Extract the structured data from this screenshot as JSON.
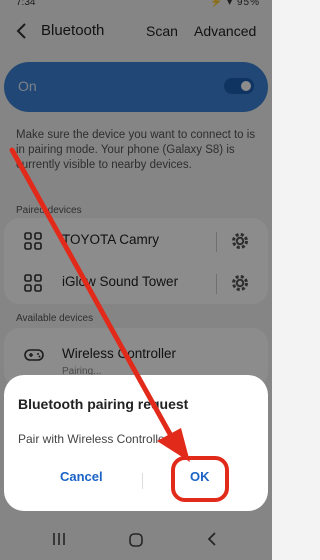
{
  "status_bar": {
    "time": "7:34",
    "battery": "95%"
  },
  "header": {
    "title": "Bluetooth",
    "scan": "Scan",
    "advanced": "Advanced"
  },
  "master_toggle": {
    "label": "On",
    "state": "on"
  },
  "info_text": "Make sure the device you want to connect to is in pairing mode. Your phone (Galaxy S8) is currently visible to nearby devices.",
  "paired": {
    "label": "Paired devices",
    "devices": [
      {
        "name": "TOYOTA Camry",
        "icon": "grid-device-icon"
      },
      {
        "name": "iGlow Sound Tower",
        "icon": "grid-device-icon"
      }
    ]
  },
  "available": {
    "label": "Available devices",
    "devices": [
      {
        "name": "Wireless Controller",
        "status": "Pairing...",
        "icon": "gamepad-icon"
      }
    ]
  },
  "dialog": {
    "title": "Bluetooth pairing request",
    "message": "Pair with Wireless Controller?",
    "cancel": "Cancel",
    "ok": "OK"
  },
  "nav": {
    "recent": "recent-apps-icon",
    "home": "home-icon",
    "back": "back-icon"
  },
  "annotation": {
    "color": "#e22a1a"
  }
}
